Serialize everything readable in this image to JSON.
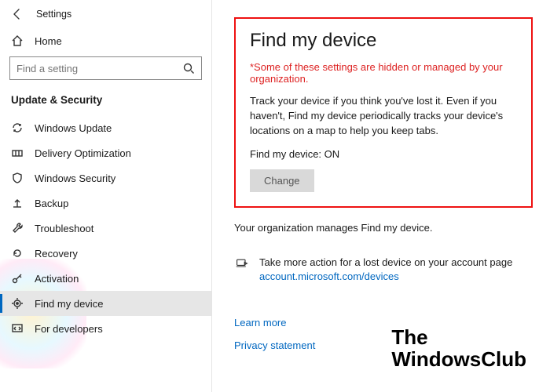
{
  "header": {
    "title": "Settings"
  },
  "home": {
    "label": "Home"
  },
  "search": {
    "placeholder": "Find a setting"
  },
  "category": "Update & Security",
  "sidebar": {
    "items": [
      {
        "label": "Windows Update"
      },
      {
        "label": "Delivery Optimization"
      },
      {
        "label": "Windows Security"
      },
      {
        "label": "Backup"
      },
      {
        "label": "Troubleshoot"
      },
      {
        "label": "Recovery"
      },
      {
        "label": "Activation"
      },
      {
        "label": "Find my device"
      },
      {
        "label": "For developers"
      }
    ]
  },
  "page": {
    "title": "Find my device",
    "warning": "*Some of these settings are hidden or managed by your organization.",
    "description": "Track your device if you think you've lost it. Even if you haven't, Find my device periodically tracks your device's locations on a map to help you keep tabs.",
    "status_label": "Find my device: ON",
    "change_button": "Change",
    "org_note": "Your organization manages Find my device.",
    "action_line": "Take more action for a lost device on your account page",
    "action_link": "account.microsoft.com/devices",
    "learn_more": "Learn more",
    "privacy": "Privacy statement"
  },
  "watermark": {
    "line1": "The",
    "line2": "WindowsClub"
  }
}
